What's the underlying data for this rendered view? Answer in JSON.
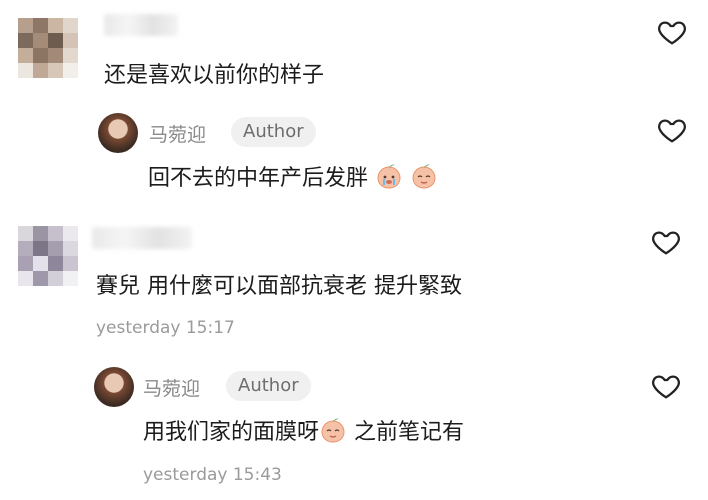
{
  "comments": [
    {
      "text": "还是喜欢以前你的样子"
    },
    {
      "author": "马菀迎",
      "badge": "Author",
      "text": "回不去的中年产后发胖"
    },
    {
      "text": "賽兒 用什麼可以面部抗衰老 提升緊致",
      "time": "yesterday 15:17"
    },
    {
      "author": "马菀迎",
      "badge": "Author",
      "text_before": "用我们家的面膜呀",
      "text_after": " 之前笔记有",
      "time": "yesterday 15:43"
    }
  ],
  "icons": {
    "like": "heart-outline-icon",
    "emoji": "peach-emoji-icon"
  }
}
